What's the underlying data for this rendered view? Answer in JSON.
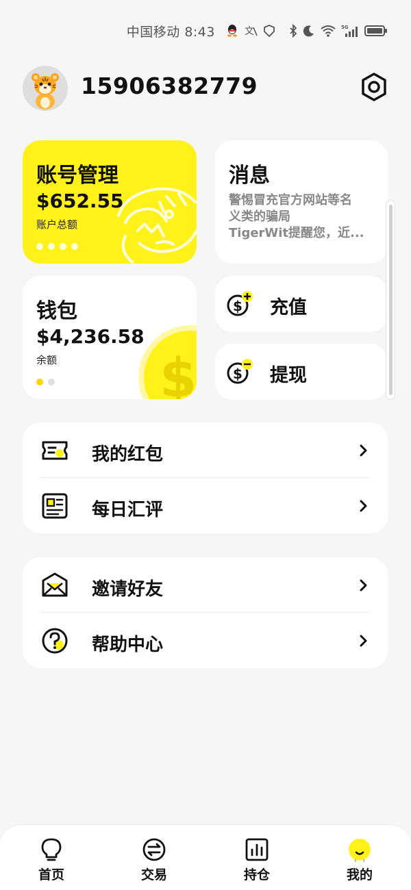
{
  "status_bar": {
    "carrier_time": "中国移动 8:43",
    "icons": [
      "qq-icon",
      "translate-icon",
      "shield-icon",
      "bluetooth-icon",
      "moon-icon",
      "wifi-icon",
      "signal-5g-icon",
      "battery-icon"
    ]
  },
  "header": {
    "phone": "15906382779",
    "avatar_icon": "tiger-avatar",
    "settings_icon": "settings-icon"
  },
  "cards": {
    "account": {
      "title": "账号管理",
      "amount": "$652.55",
      "sub": "账户总额",
      "pages": 4,
      "active_page": 1
    },
    "message": {
      "title": "消息",
      "lines": [
        "警惕冒充官方网站等名",
        "义类的骗局",
        "TigerWit提醒您，近..."
      ]
    },
    "wallet": {
      "title": "钱包",
      "amount": "$4,236.58",
      "sub": "余额",
      "pages": 2,
      "active_page": 1
    },
    "recharge": {
      "label": "充值",
      "icon": "dollar-plus-icon"
    },
    "withdraw": {
      "label": "提现",
      "icon": "dollar-minus-icon"
    }
  },
  "menu_groups": [
    {
      "items": [
        {
          "label": "我的红包",
          "icon": "ticket-icon"
        },
        {
          "label": "每日汇评",
          "icon": "news-icon"
        }
      ]
    },
    {
      "items": [
        {
          "label": "邀请好友",
          "icon": "envelope-icon"
        },
        {
          "label": "帮助中心",
          "icon": "help-icon"
        }
      ]
    }
  ],
  "bottom_nav": {
    "items": [
      {
        "label": "首页",
        "icon": "lightbulb-icon"
      },
      {
        "label": "交易",
        "icon": "exchange-icon"
      },
      {
        "label": "持仓",
        "icon": "chart-icon"
      },
      {
        "label": "我的",
        "icon": "profile-icon",
        "active": true
      }
    ]
  },
  "colors": {
    "accent": "#FFF21A",
    "background": "#F6F6F6",
    "text": "#111111",
    "muted": "#888888"
  }
}
